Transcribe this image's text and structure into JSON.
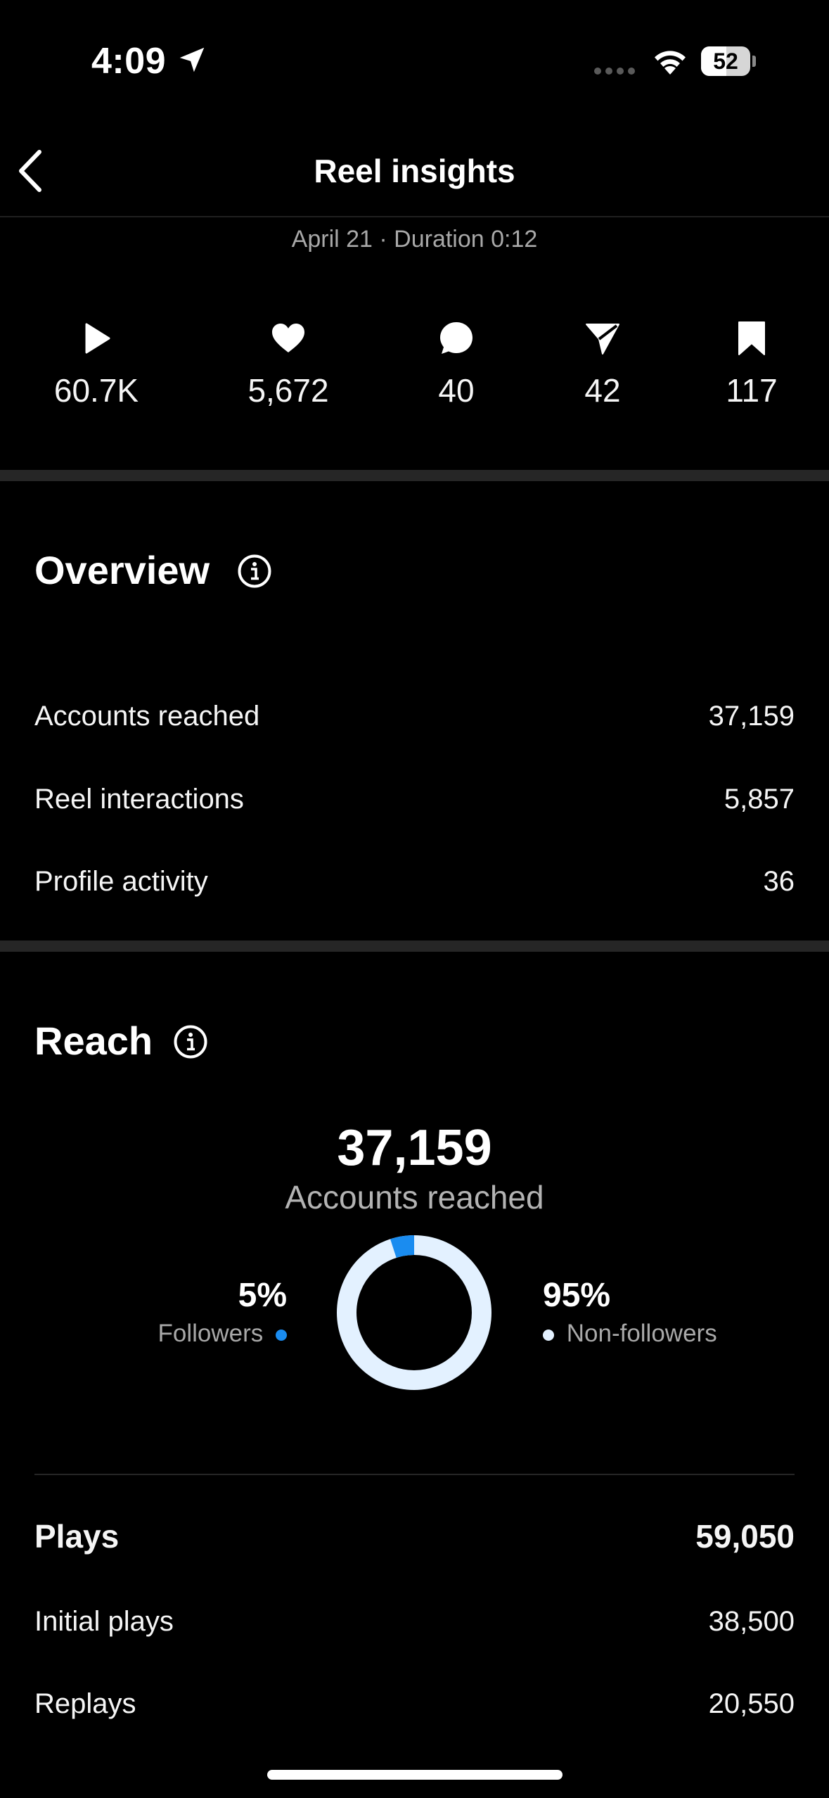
{
  "status_bar": {
    "time": "4:09",
    "battery": "52",
    "battery_level": 0.52,
    "icons": [
      "location-arrow-icon",
      "cellular-signal-icon",
      "wifi-icon",
      "battery-icon"
    ]
  },
  "header": {
    "title": "Reel insights",
    "subtitle": "April 21 · Duration 0:12",
    "back_icon": "chevron-left-icon"
  },
  "stats": [
    {
      "icon": "play-icon",
      "value": "60.7K"
    },
    {
      "icon": "heart-icon",
      "value": "5,672"
    },
    {
      "icon": "comment-icon",
      "value": "40"
    },
    {
      "icon": "share-icon",
      "value": "42"
    },
    {
      "icon": "bookmark-icon",
      "value": "117"
    }
  ],
  "overview": {
    "title": "Overview",
    "rows": [
      {
        "label": "Accounts reached",
        "value": "37,159"
      },
      {
        "label": "Reel interactions",
        "value": "5,857"
      },
      {
        "label": "Profile activity",
        "value": "36"
      }
    ]
  },
  "reach": {
    "title": "Reach",
    "total": "37,159",
    "total_label": "Accounts reached",
    "followers": {
      "percent": "5%",
      "label": "Followers",
      "fraction": 0.05,
      "color": "#1a8cf0"
    },
    "non_followers": {
      "percent": "95%",
      "label": "Non-followers",
      "fraction": 0.95,
      "color": "#e3f1ff"
    },
    "plays": {
      "label": "Plays",
      "value": "59,050"
    },
    "rows": [
      {
        "label": "Initial plays",
        "value": "38,500"
      },
      {
        "label": "Replays",
        "value": "20,550"
      }
    ]
  }
}
